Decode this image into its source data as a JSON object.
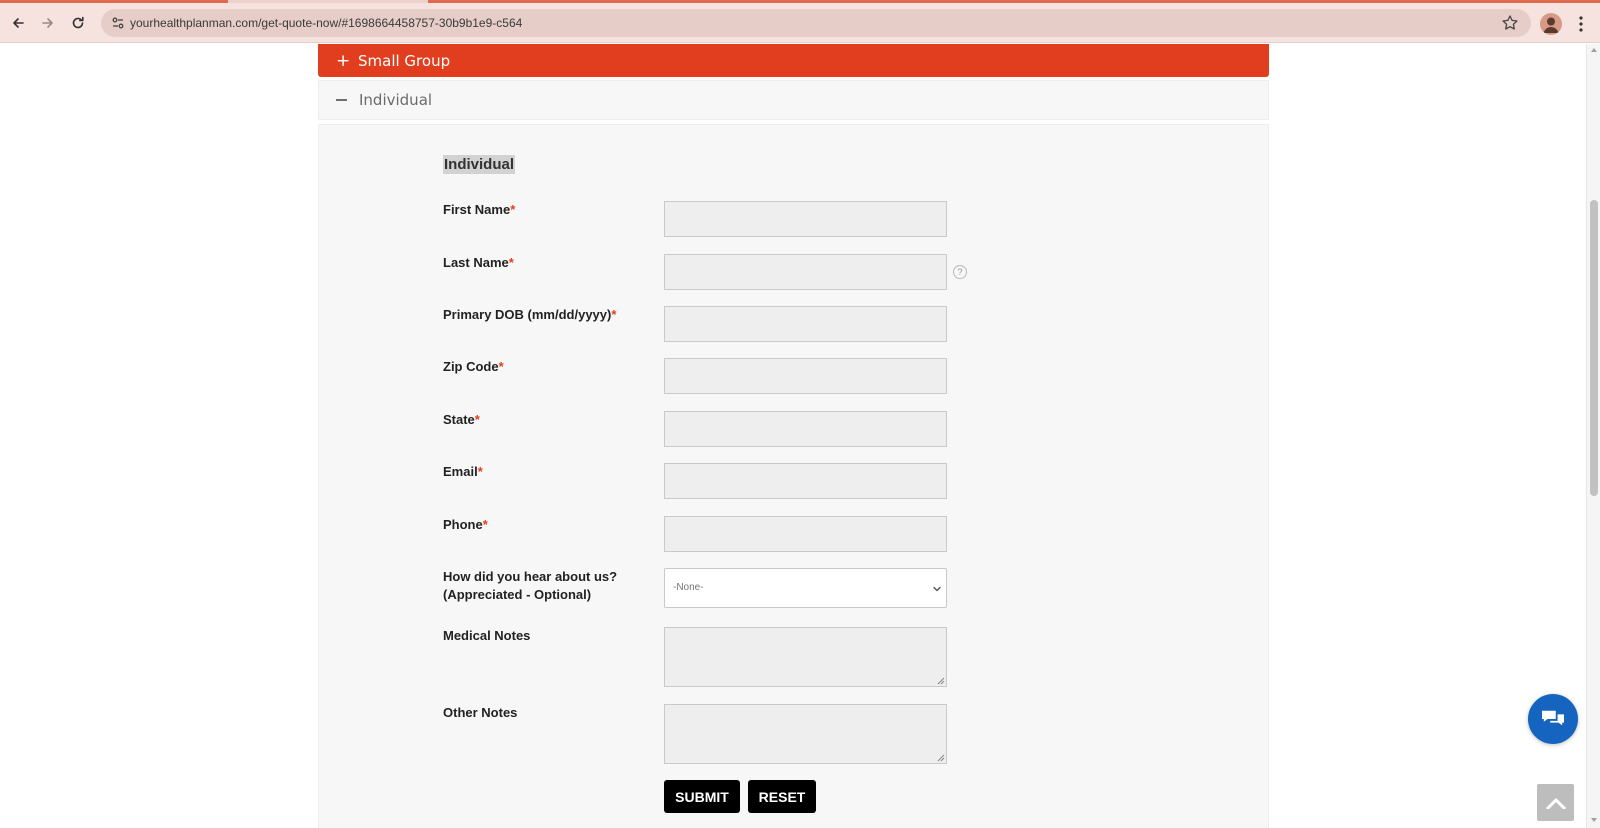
{
  "browser": {
    "url": "yourhealthplanman.com/get-quote-now/#1698664458757-30b9b1e9-c564"
  },
  "accordion": {
    "small_group": {
      "icon": "+",
      "label": "Small Group"
    },
    "individual": {
      "label": "Individual"
    }
  },
  "form": {
    "heading": "Individual",
    "required_mark": "*",
    "fields": [
      {
        "label": "First Name",
        "required": true
      },
      {
        "label": "Last Name",
        "required": true
      },
      {
        "label": "Primary DOB (mm/dd/yyyy)",
        "required": true
      },
      {
        "label": "Zip Code",
        "required": true
      },
      {
        "label": "State",
        "required": true
      },
      {
        "label": "Email",
        "required": true
      },
      {
        "label": "Phone",
        "required": true
      }
    ],
    "hear_about": {
      "label_line1": "How did you hear about us?",
      "label_line2": "(Appreciated - Optional)",
      "selected": "-None-"
    },
    "medical_notes_label": "Medical Notes",
    "other_notes_label": "Other Notes",
    "help_glyph": "?",
    "submit_label": "SUBMIT",
    "reset_label": "RESET"
  },
  "colors": {
    "accent": "#e03e1f",
    "chat": "#1565c0"
  }
}
